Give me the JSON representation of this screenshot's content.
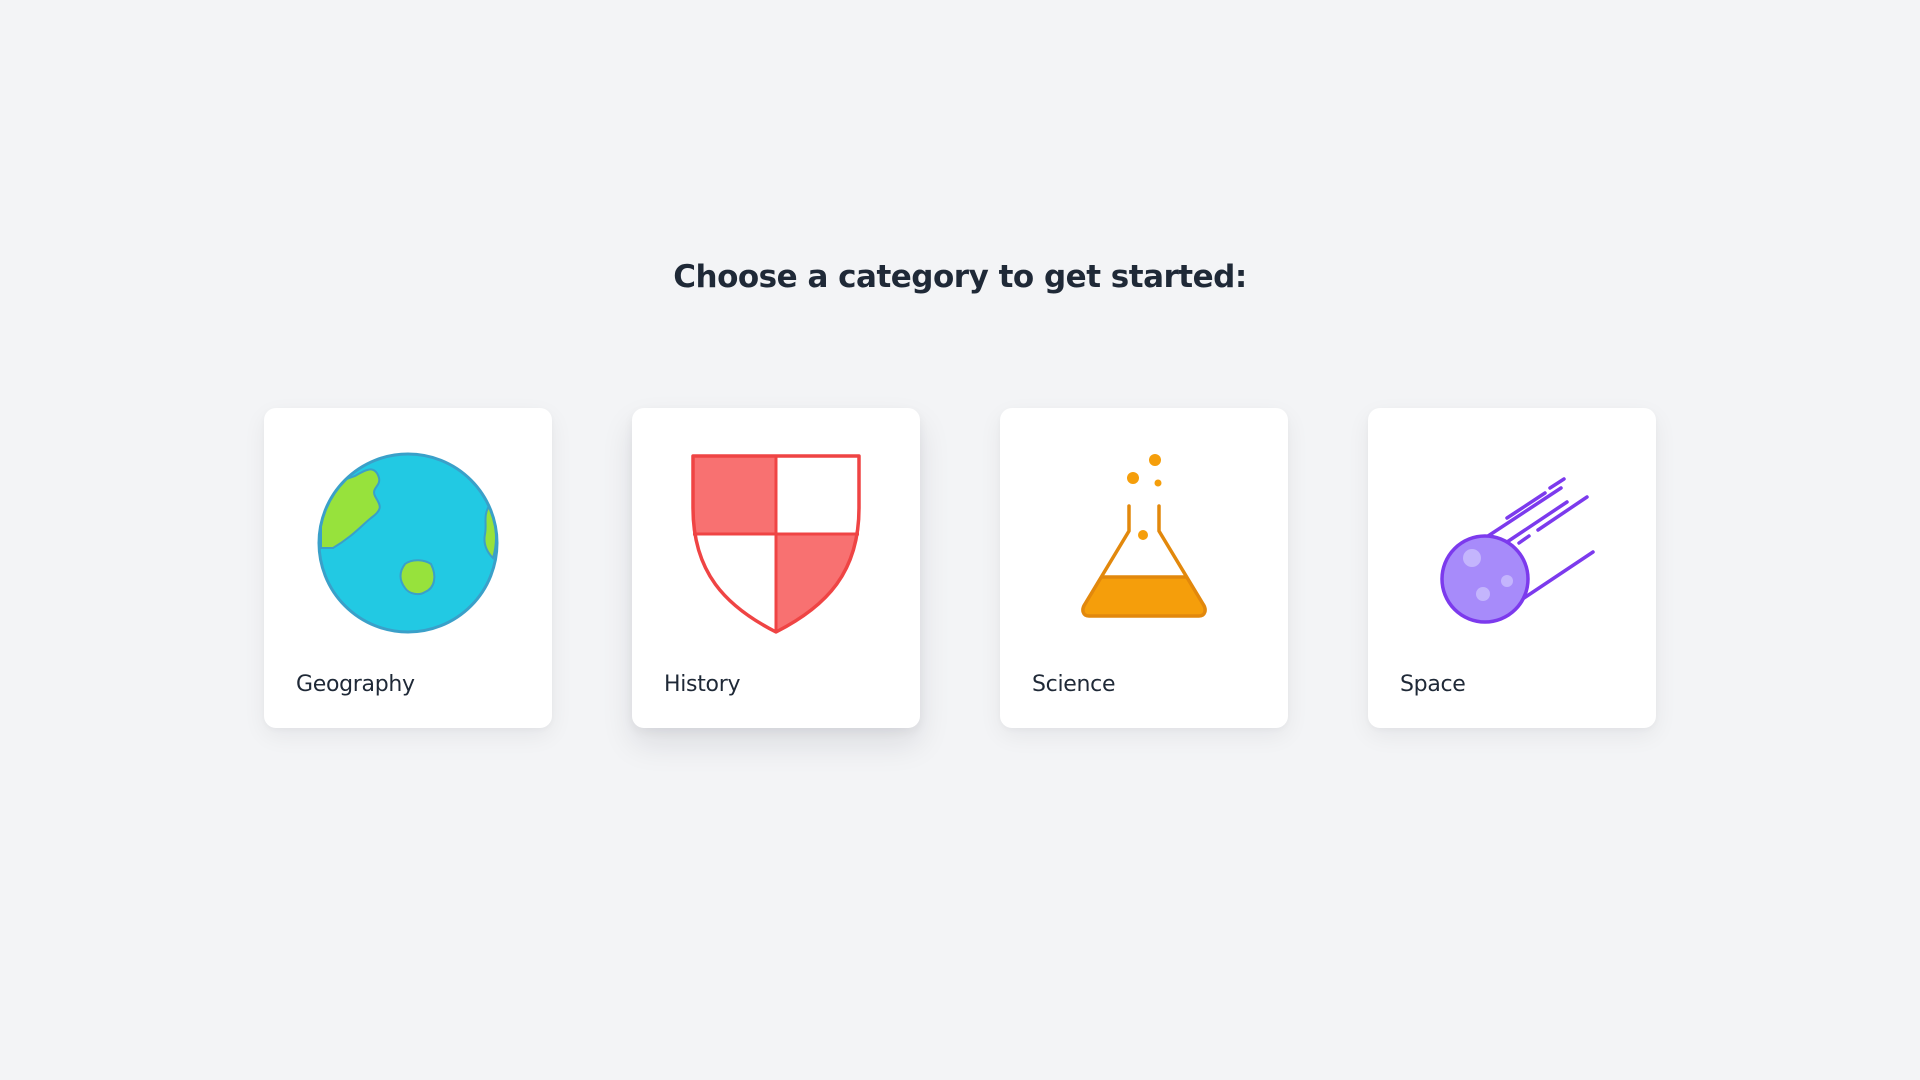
{
  "prompt": {
    "title": "Choose a category to get started:"
  },
  "categories": [
    {
      "label": "Geography",
      "icon": "globe-icon",
      "color": "#22c9e3"
    },
    {
      "label": "History",
      "icon": "shield-icon",
      "color": "#ef4444"
    },
    {
      "label": "Science",
      "icon": "flask-icon",
      "color": "#f59e0b"
    },
    {
      "label": "Space",
      "icon": "comet-icon",
      "color": "#7c3aed"
    }
  ]
}
